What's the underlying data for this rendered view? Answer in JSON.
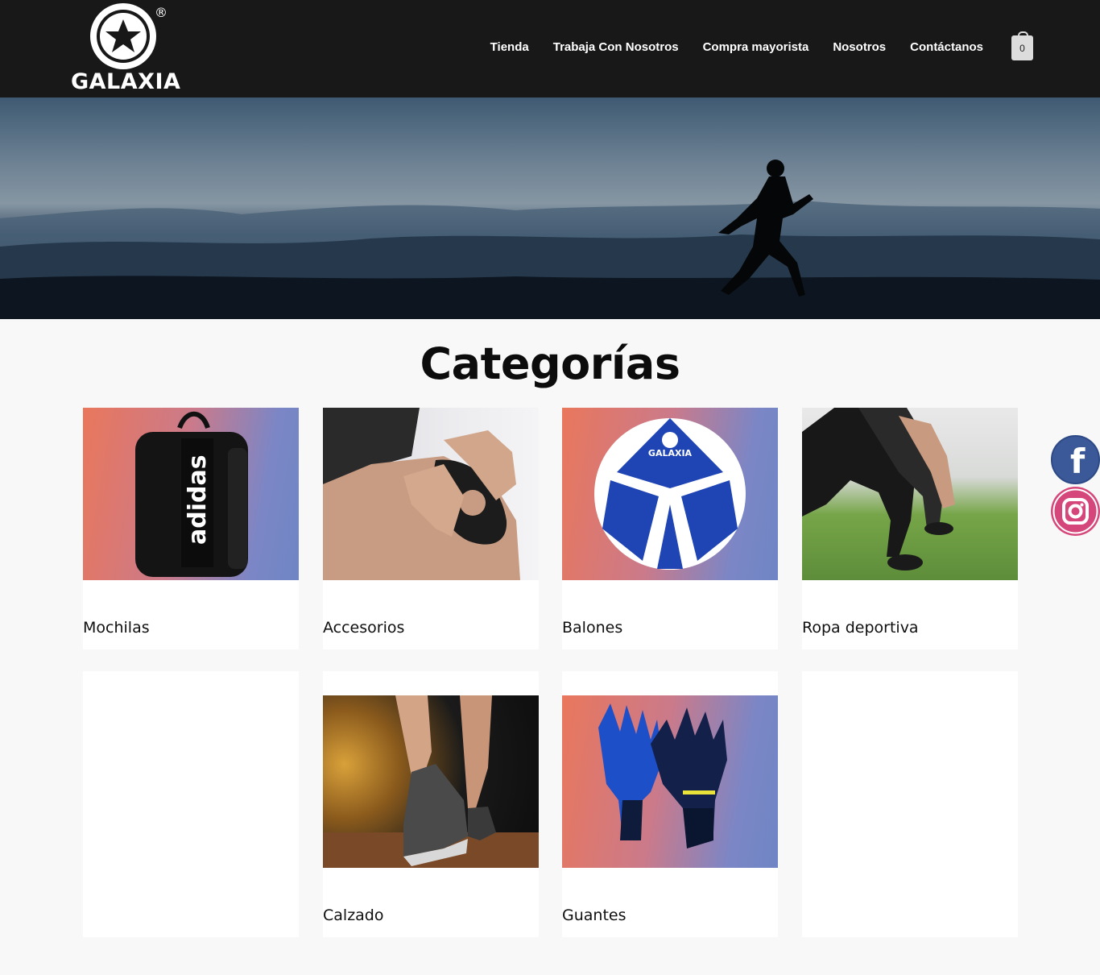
{
  "brand": {
    "name": "GALAXIA",
    "reg": "®"
  },
  "nav": {
    "items": [
      "Tienda",
      "Trabaja Con Nosotros",
      "Compra mayorista",
      "Nosotros",
      "Contáctanos"
    ],
    "cart_count": "0"
  },
  "main": {
    "title": "Categorías"
  },
  "categories": [
    {
      "label": "Mochilas",
      "icon": "backpack-image"
    },
    {
      "label": "Accesorios",
      "icon": "knee-brace-image"
    },
    {
      "label": "Balones",
      "icon": "ball-image"
    },
    {
      "label": "Ropa deportiva",
      "icon": "sportswear-image"
    },
    {
      "label": "",
      "icon": ""
    },
    {
      "label": "Calzado",
      "icon": "shoe-image"
    },
    {
      "label": "Guantes",
      "icon": "gloves-image"
    },
    {
      "label": "",
      "icon": ""
    }
  ],
  "product_text": {
    "backpack_brand": "adidas",
    "ball_brand": "GALAXIA"
  },
  "social": {
    "facebook_icon": "facebook-icon",
    "instagram_icon": "instagram-icon"
  },
  "colors": {
    "header_bg": "#181818",
    "facebook": "#3b5998",
    "instagram": "#d5477a"
  }
}
